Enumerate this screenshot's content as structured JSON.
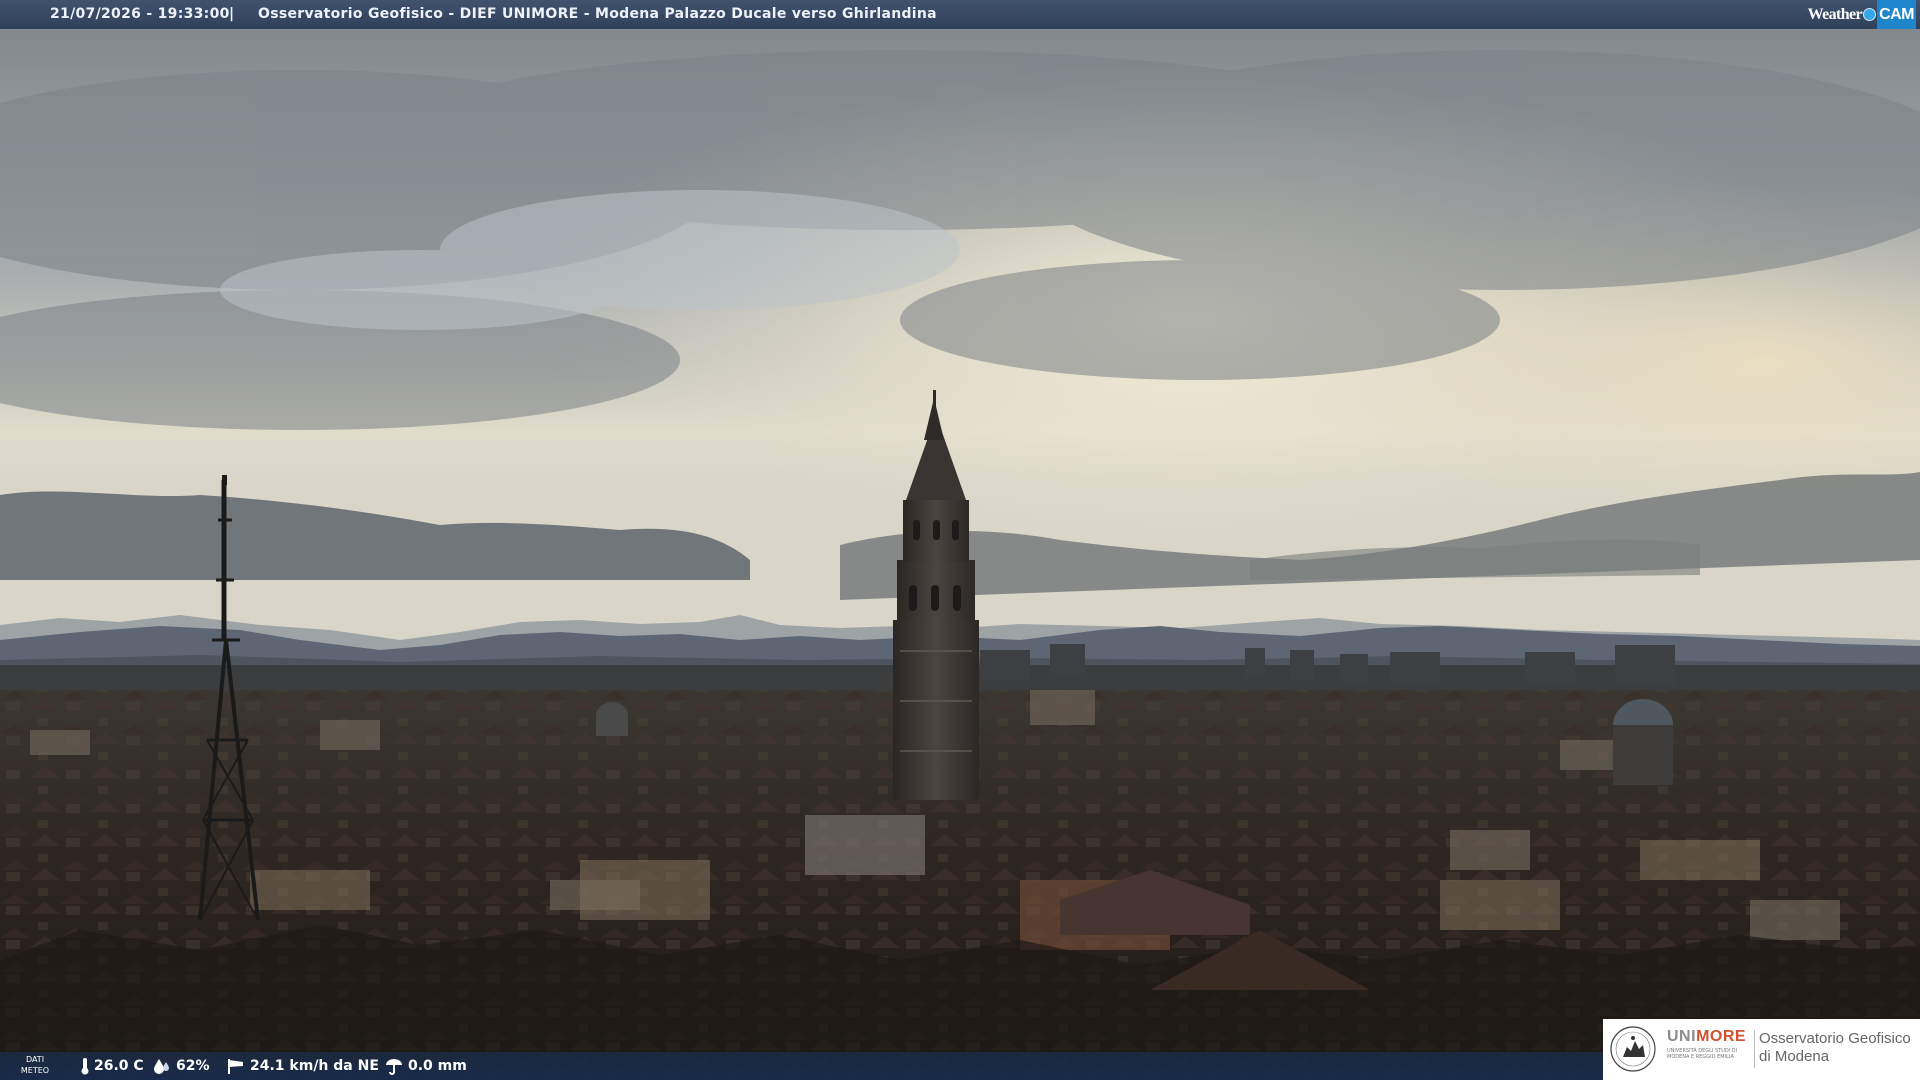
{
  "overlay": {
    "timestamp": "21/07/2026 - 19:33:00",
    "separator": "|",
    "title": "Osservatorio Geofisico - DIEF UNIMORE - Modena Palazzo Ducale verso Ghirlandina",
    "brand": {
      "weather": "Weather",
      "cam": "CAM",
      "dot_color": "#35a7e8",
      "cam_color": "#1f86cc"
    }
  },
  "weather_bar": {
    "dati_line1": "DATI",
    "dati_line2": "METEO",
    "temperature": "26.0 C",
    "humidity": "62%",
    "wind": "24.1 km/h da NE",
    "rain": "0.0 mm",
    "icons": [
      "thermometer-icon",
      "humidity-drop-icon",
      "wind-sock-icon",
      "rain-gauge-icon"
    ]
  },
  "logo": {
    "uni_grey": "UNI",
    "uni_red": "MORE",
    "uni_sub": "UNIVERSITÀ DEGLI STUDI DI MODENA E REGGIO EMILIA",
    "obs_line1": "Osservatorio Geofisico",
    "obs_line2": "di Modena"
  },
  "scene": {
    "description_colors": {
      "sky_top": "#8f9499",
      "sky_glow": "#f3ead2",
      "mountains": "#5a6573",
      "roofs": "#2d2522"
    }
  }
}
